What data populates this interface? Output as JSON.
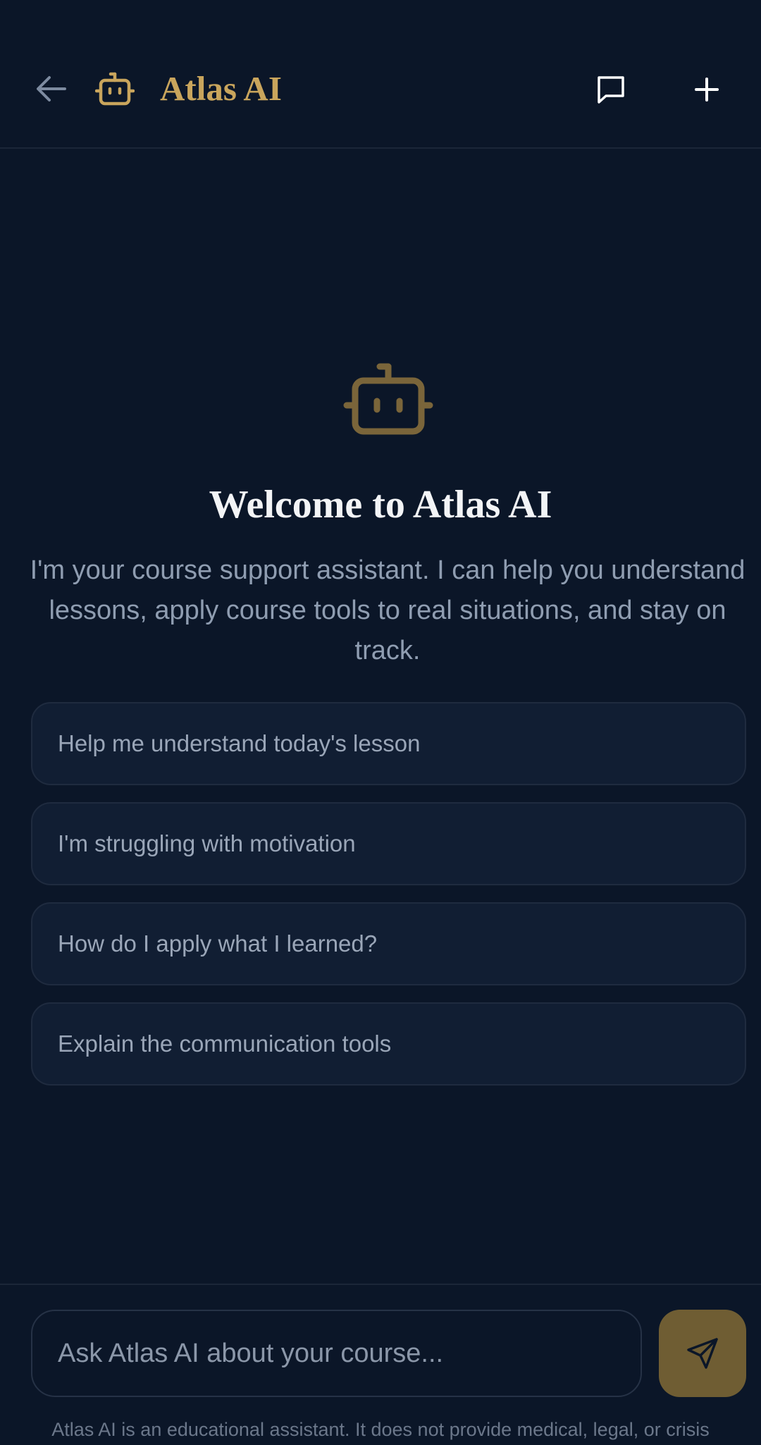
{
  "header": {
    "back_icon": "arrow-left-icon",
    "logo_icon": "robot-icon",
    "title": "Atlas AI",
    "chat_icon": "chat-bubble-icon",
    "new_icon": "plus-icon"
  },
  "welcome": {
    "icon": "robot-icon",
    "title": "Welcome to Atlas AI",
    "description": "I'm your course support assistant. I can help you understand lessons, apply course tools to real situations, and stay on track."
  },
  "suggestions": [
    {
      "label": "Help me understand today's lesson"
    },
    {
      "label": "I'm struggling with motivation"
    },
    {
      "label": "How do I apply what I learned?"
    },
    {
      "label": "Explain the communication tools"
    }
  ],
  "composer": {
    "placeholder": "Ask Atlas AI about your course...",
    "value": "",
    "send_icon": "send-icon"
  },
  "disclaimer": "Atlas AI is an educational assistant. It does not provide medical, legal, or crisis",
  "colors": {
    "background": "#0b1628",
    "accent": "#c9a55c",
    "card": "#111e33",
    "send_button": "#6f5d33"
  }
}
